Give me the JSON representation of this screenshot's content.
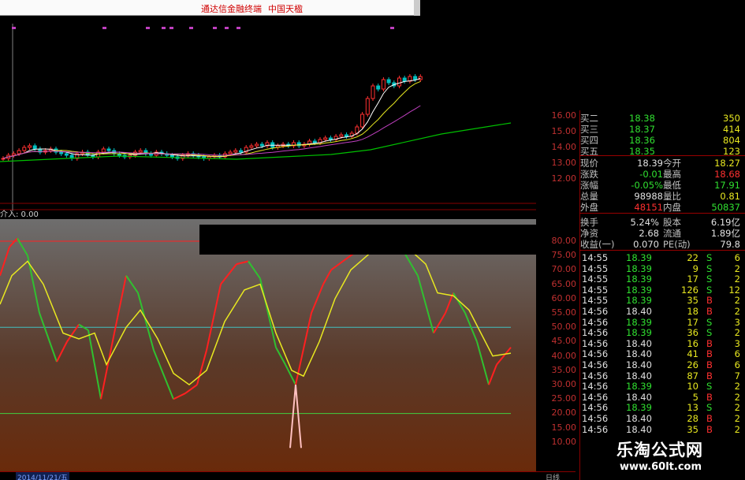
{
  "titlebar": {
    "title": "通达信金融终端",
    "subtitle": "中国天楹"
  },
  "indicator": {
    "label": "介入: 0.00"
  },
  "price_axis": {
    "top": [
      "16.00",
      "15.00",
      "14.00",
      "13.00",
      "12.00"
    ],
    "osc": [
      "80.00",
      "75.00",
      "70.00",
      "65.00",
      "60.00",
      "55.00",
      "50.00",
      "45.00",
      "40.00",
      "35.00",
      "30.00",
      "25.00",
      "20.00",
      "15.00",
      "10.00"
    ]
  },
  "order_book": [
    {
      "label": "买二",
      "price": "18.38",
      "vol": "350"
    },
    {
      "label": "买三",
      "price": "18.37",
      "vol": "414"
    },
    {
      "label": "买四",
      "price": "18.36",
      "vol": "804"
    },
    {
      "label": "买五",
      "price": "18.35",
      "vol": "123"
    }
  ],
  "stats": [
    {
      "l1": "现价",
      "v1": "18.39",
      "l2": "今开",
      "v2": "18.27"
    },
    {
      "l1": "涨跌",
      "v1": "-0.01",
      "l2": "最高",
      "v2": "18.68"
    },
    {
      "l1": "涨幅",
      "v1": "-0.05%",
      "l2": "最低",
      "v2": "17.91"
    },
    {
      "l1": "总量",
      "v1": "98988",
      "l2": "量比",
      "v2": "0.81"
    },
    {
      "l1": "外盘",
      "v1": "48151",
      "l2": "内盘",
      "v2": "50837"
    }
  ],
  "stats2": [
    {
      "l1": "换手",
      "v1": "5.24%",
      "l2": "股本",
      "v2": "6.19亿"
    },
    {
      "l1": "净资",
      "v1": "2.68",
      "l2": "流通",
      "v2": "1.89亿"
    },
    {
      "l1": "收益(一)",
      "v1": "0.070",
      "l2": "PE(动)",
      "v2": "79.8"
    }
  ],
  "ticks": [
    {
      "time": "14:55",
      "price": "18.39",
      "vol": "22",
      "side": "S",
      "n": "6"
    },
    {
      "time": "14:55",
      "price": "18.39",
      "vol": "9",
      "side": "S",
      "n": "2"
    },
    {
      "time": "14:55",
      "price": "18.39",
      "vol": "17",
      "side": "S",
      "n": "2"
    },
    {
      "time": "14:55",
      "price": "18.39",
      "vol": "126",
      "side": "S",
      "n": "12"
    },
    {
      "time": "14:55",
      "price": "18.39",
      "vol": "35",
      "side": "B",
      "n": "2"
    },
    {
      "time": "14:56",
      "price": "18.40",
      "vol": "18",
      "side": "B",
      "n": "2"
    },
    {
      "time": "14:56",
      "price": "18.39",
      "vol": "17",
      "side": "S",
      "n": "3"
    },
    {
      "time": "14:56",
      "price": "18.39",
      "vol": "36",
      "side": "S",
      "n": "2"
    },
    {
      "time": "14:56",
      "price": "18.40",
      "vol": "16",
      "side": "B",
      "n": "3"
    },
    {
      "time": "14:56",
      "price": "18.40",
      "vol": "41",
      "side": "B",
      "n": "6"
    },
    {
      "time": "14:56",
      "price": "18.40",
      "vol": "26",
      "side": "B",
      "n": "6"
    },
    {
      "time": "14:56",
      "price": "18.40",
      "vol": "87",
      "side": "B",
      "n": "7"
    },
    {
      "time": "14:56",
      "price": "18.39",
      "vol": "10",
      "side": "S",
      "n": "2"
    },
    {
      "time": "14:56",
      "price": "18.40",
      "vol": "5",
      "side": "B",
      "n": "2"
    },
    {
      "time": "14:56",
      "price": "18.39",
      "vol": "13",
      "side": "S",
      "n": "2"
    },
    {
      "time": "14:56",
      "price": "18.40",
      "vol": "28",
      "side": "B",
      "n": "2"
    },
    {
      "time": "14:56",
      "price": "18.40",
      "vol": "35",
      "side": "B",
      "n": "2"
    }
  ],
  "datebar": {
    "date": "2014/11/21/五",
    "unit": "日线"
  },
  "watermark": {
    "line1": "乐淘公式网",
    "line2": "www.60lt.com"
  },
  "colors": {
    "up": "#ff3030",
    "down": "#00c0c0",
    "buy": "#ff3030",
    "sell": "#00c000",
    "yellow": "#e8e820",
    "axis": "#c03030"
  }
}
